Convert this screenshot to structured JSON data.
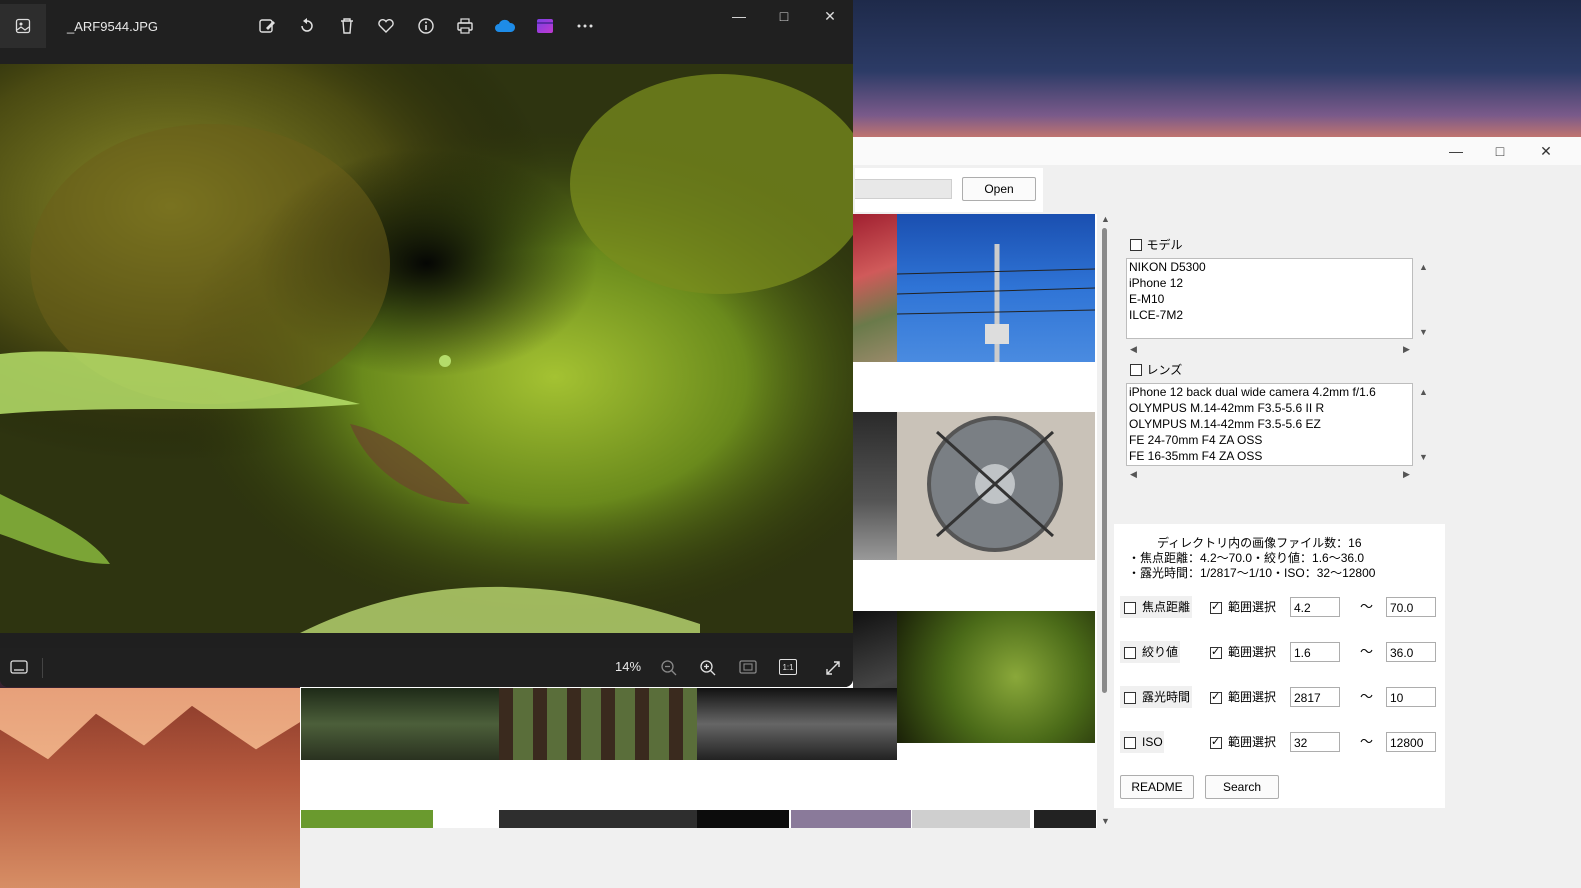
{
  "viewer": {
    "filename": "_ARF9544.JPG",
    "zoom": "14%",
    "toolbar_icons": [
      "edit-icon",
      "rotate-icon",
      "delete-icon",
      "favorite-icon",
      "info-icon",
      "print-icon",
      "onedrive-icon",
      "clipchamp-icon",
      "more-icon"
    ],
    "one_to_one": "1:1"
  },
  "app": {
    "open_label": "Open",
    "model_label": "モデル",
    "models": [
      "NIKON D5300",
      "iPhone 12",
      "E-M10",
      "ILCE-7M2"
    ],
    "lens_label": "レンズ",
    "lenses": [
      "iPhone 12 back dual wide camera 4.2mm f/1.6",
      "OLYMPUS M.14-42mm F3.5-5.6 II R",
      "OLYMPUS M.14-42mm F3.5-5.6 EZ",
      "FE 24-70mm F4 ZA OSS",
      "FE 16-35mm F4 ZA OSS"
    ],
    "info": {
      "line1": "ディレクトリ内の画像ファイル数：16",
      "line2": "・焦点距離：4.2〜70.0・絞り値：1.6〜36.0",
      "line3": "・露光時間：1/2817〜1/10・ISO：32〜12800"
    },
    "range_label": "範囲選択",
    "tilde": "〜",
    "rows": [
      {
        "label": "焦点距離",
        "min": "4.2",
        "max": "70.0"
      },
      {
        "label": "絞り値",
        "min": "1.6",
        "max": "36.0"
      },
      {
        "label": "露光時間",
        "min": "2817",
        "max": "10"
      },
      {
        "label": "ISO",
        "min": "32",
        "max": "12800"
      }
    ],
    "readme_label": "README",
    "search_label": "Search"
  },
  "colors": {
    "viewer_bg": "#202020",
    "window_bg": "#f0f0f0",
    "accent_blue": "#0078d4"
  }
}
